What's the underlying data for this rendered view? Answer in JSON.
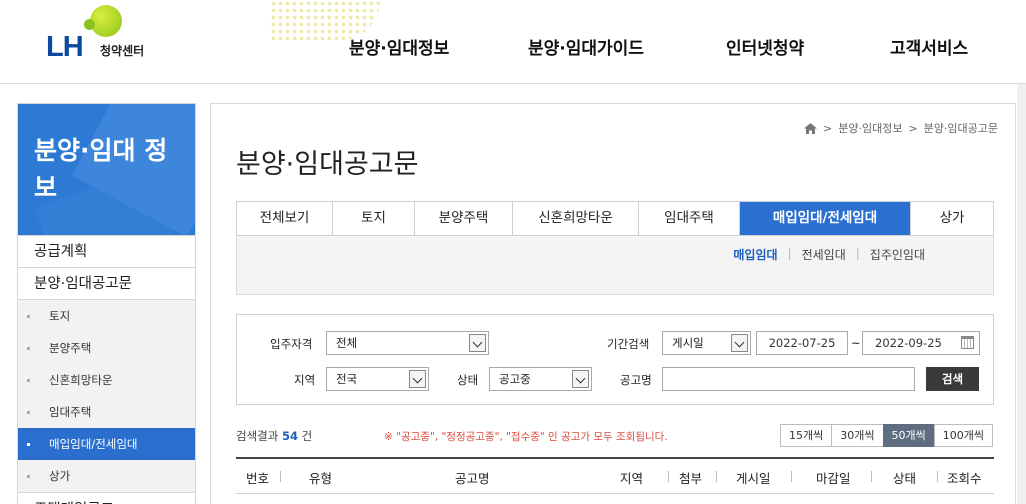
{
  "header": {
    "logo_text": "LH",
    "logo_sub": "청약센터",
    "nav": [
      "분양·임대정보",
      "분양·임대가이드",
      "인터넷청약",
      "고객서비스"
    ]
  },
  "sidebar": {
    "title": "분양·임대 정보",
    "items": [
      {
        "label": "공급계획"
      },
      {
        "label": "분양·임대공고문"
      }
    ],
    "subitems": [
      {
        "label": "토지"
      },
      {
        "label": "분양주택"
      },
      {
        "label": "신혼희망타운"
      },
      {
        "label": "임대주택"
      },
      {
        "label": "매입임대/전세임대",
        "active": true
      },
      {
        "label": "상가"
      }
    ],
    "next_item": "주택매입공고"
  },
  "breadcrumb": [
    "분양·임대정보",
    "분양·임대공고문"
  ],
  "page_title": "분양·임대공고문",
  "tabs": [
    "전체보기",
    "토지",
    "분양주택",
    "신혼희망타운",
    "임대주택",
    "매입임대/전세임대",
    "상가"
  ],
  "active_tab": 5,
  "subtabs": [
    "매입임대",
    "전세임대",
    "집주인임대"
  ],
  "search": {
    "qual_label": "입주자격",
    "qual_value": "전체",
    "period_label": "기간검색",
    "period_value": "게시일",
    "date_from": "2022-07-25",
    "date_sep": "~",
    "date_to": "2022-09-25",
    "region_label": "지역",
    "region_value": "전국",
    "status_label": "상태",
    "status_value": "공고중",
    "name_label": "공고명",
    "name_value": "",
    "button": "검색"
  },
  "result": {
    "prefix": "검색결과",
    "count": "54",
    "suffix": "건",
    "notice": "※ \"공고중\", \"정정공고중\", \"접수중\" 인 공고가 모두 조회됩니다."
  },
  "page_sizes": [
    "15개씩",
    "30개씩",
    "50개씩",
    "100개씩"
  ],
  "active_page_size": 2,
  "table_headers": [
    "번호",
    "유형",
    "공고명",
    "지역",
    "첨부",
    "게시일",
    "마감일",
    "상태",
    "조회수"
  ]
}
